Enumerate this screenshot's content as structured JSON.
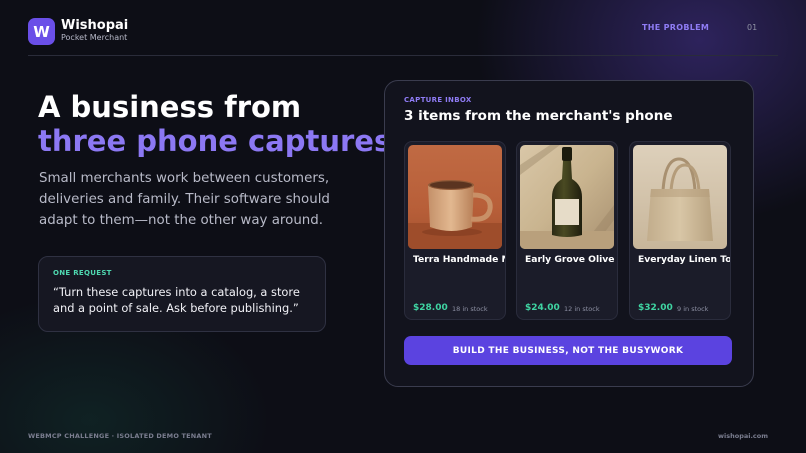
{
  "brand": {
    "logo_letter": "W",
    "name": "Wishopai",
    "tagline": "Pocket Merchant",
    "logo_color": "#6a4fe8"
  },
  "nav": {
    "section": "THE PROBLEM",
    "page_number": "01"
  },
  "hero": {
    "headline_line1": "A business from",
    "headline_line2": "three phone captures",
    "lede": "Small merchants work between customers, deliveries and family. Their software should adapt to them—not the other way around."
  },
  "request": {
    "label": "ONE REQUEST",
    "quote": "“Turn these captures into a catalog, a store and a point of sale. Ask before publishing.”"
  },
  "capture_inbox": {
    "label": "CAPTURE INBOX",
    "title": "3 items from the merchant's phone",
    "items": [
      {
        "name": "Terra Handmade Mug",
        "price": "$28.00",
        "stock": "18 in stock",
        "image_icon": "mug-photo"
      },
      {
        "name": "Early Grove Olive Oil",
        "price": "$24.00",
        "stock": "12 in stock",
        "image_icon": "olive-oil-bottle-photo"
      },
      {
        "name": "Everyday Linen Tote",
        "price": "$32.00",
        "stock": "9 in stock",
        "image_icon": "linen-tote-photo"
      }
    ],
    "cta_label": "BUILD THE BUSINESS, NOT THE BUSYWORK"
  },
  "footer": {
    "left": "WEBMCP CHALLENGE · ISOLATED DEMO TENANT",
    "right": "wishopai.com"
  },
  "colors": {
    "accent": "#8c78f3",
    "cta": "#5b43e0",
    "price": "#3fd4a2",
    "request_label": "#4fd8b0",
    "background": "#0d0e16"
  }
}
